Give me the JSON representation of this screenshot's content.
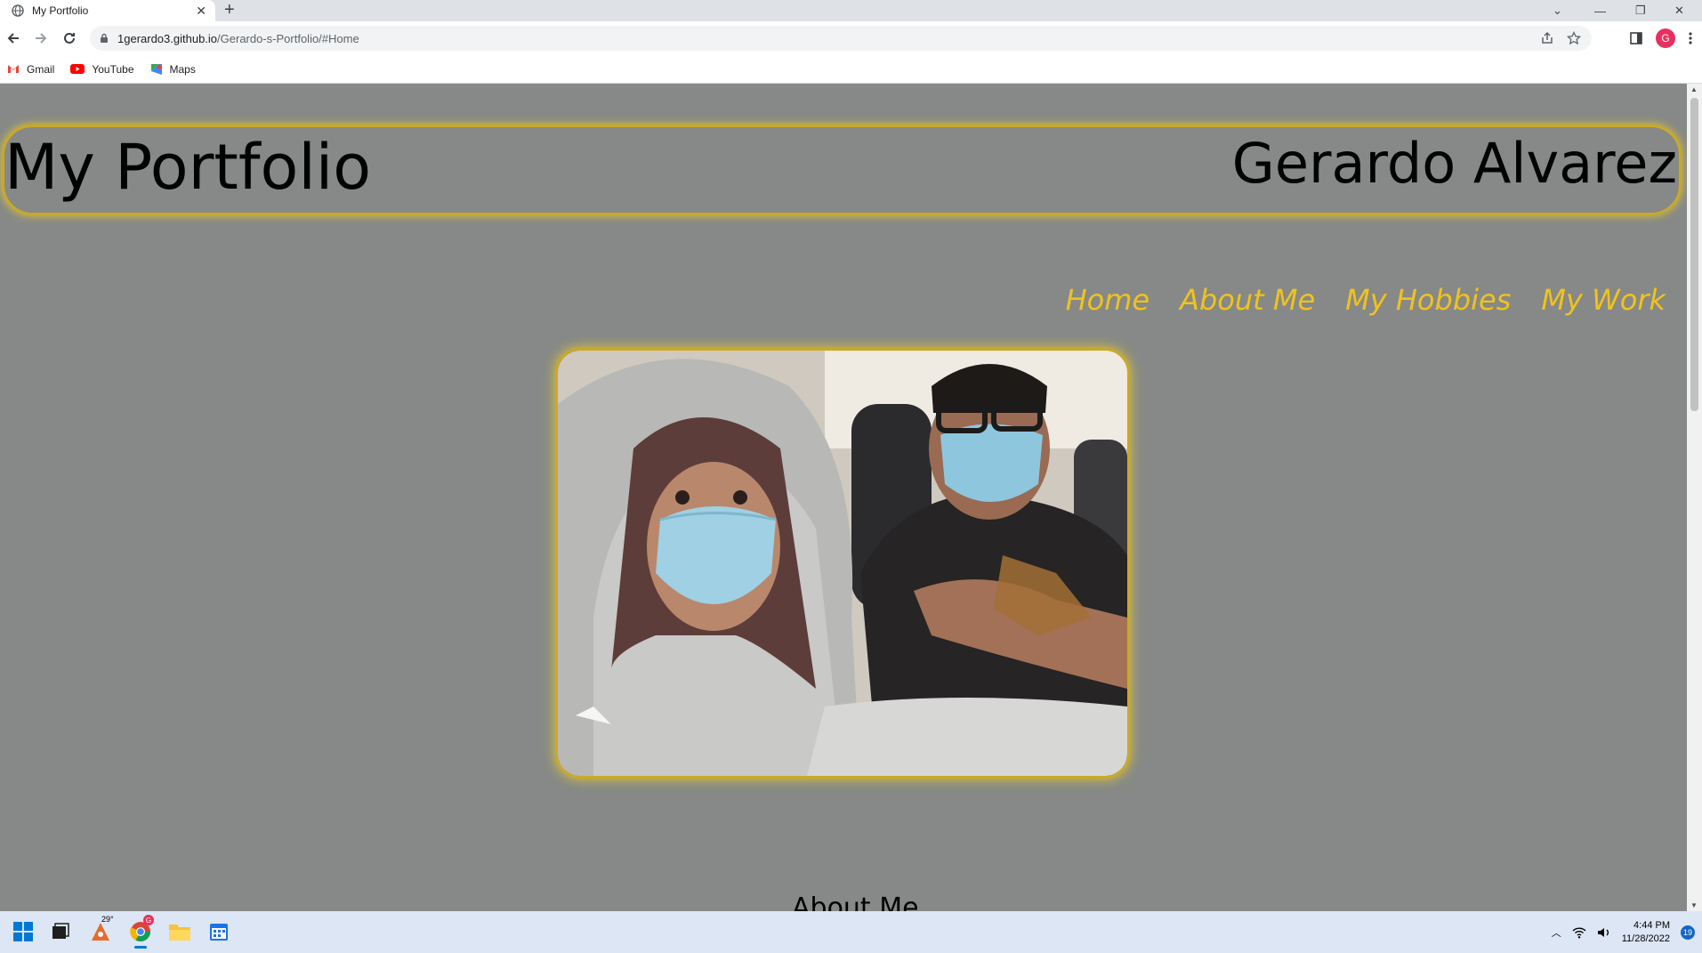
{
  "browser": {
    "tab_title": "My Portfolio",
    "new_tab": "+",
    "url_host": "1gerardo3.github.io",
    "url_path": "/Gerardo-s-Portfolio/#Home",
    "avatar_letter": "G",
    "bookmarks": [
      {
        "label": "Gmail",
        "icon": "gmail-icon"
      },
      {
        "label": "YouTube",
        "icon": "youtube-icon"
      },
      {
        "label": "Maps",
        "icon": "maps-icon"
      }
    ]
  },
  "page": {
    "site_title": "My Portfolio",
    "owner_name": "Gerardo Alvarez",
    "nav": [
      "Home",
      "About Me",
      "My Hobbies",
      "My Work"
    ],
    "peek_heading": "About Me",
    "accent_color": "#f0c21e",
    "background_color": "#868987"
  },
  "taskbar": {
    "weather_temp": "29°",
    "chrome_badge": "G",
    "time": "4:44 PM",
    "date": "11/28/2022",
    "notification_count": "19"
  }
}
